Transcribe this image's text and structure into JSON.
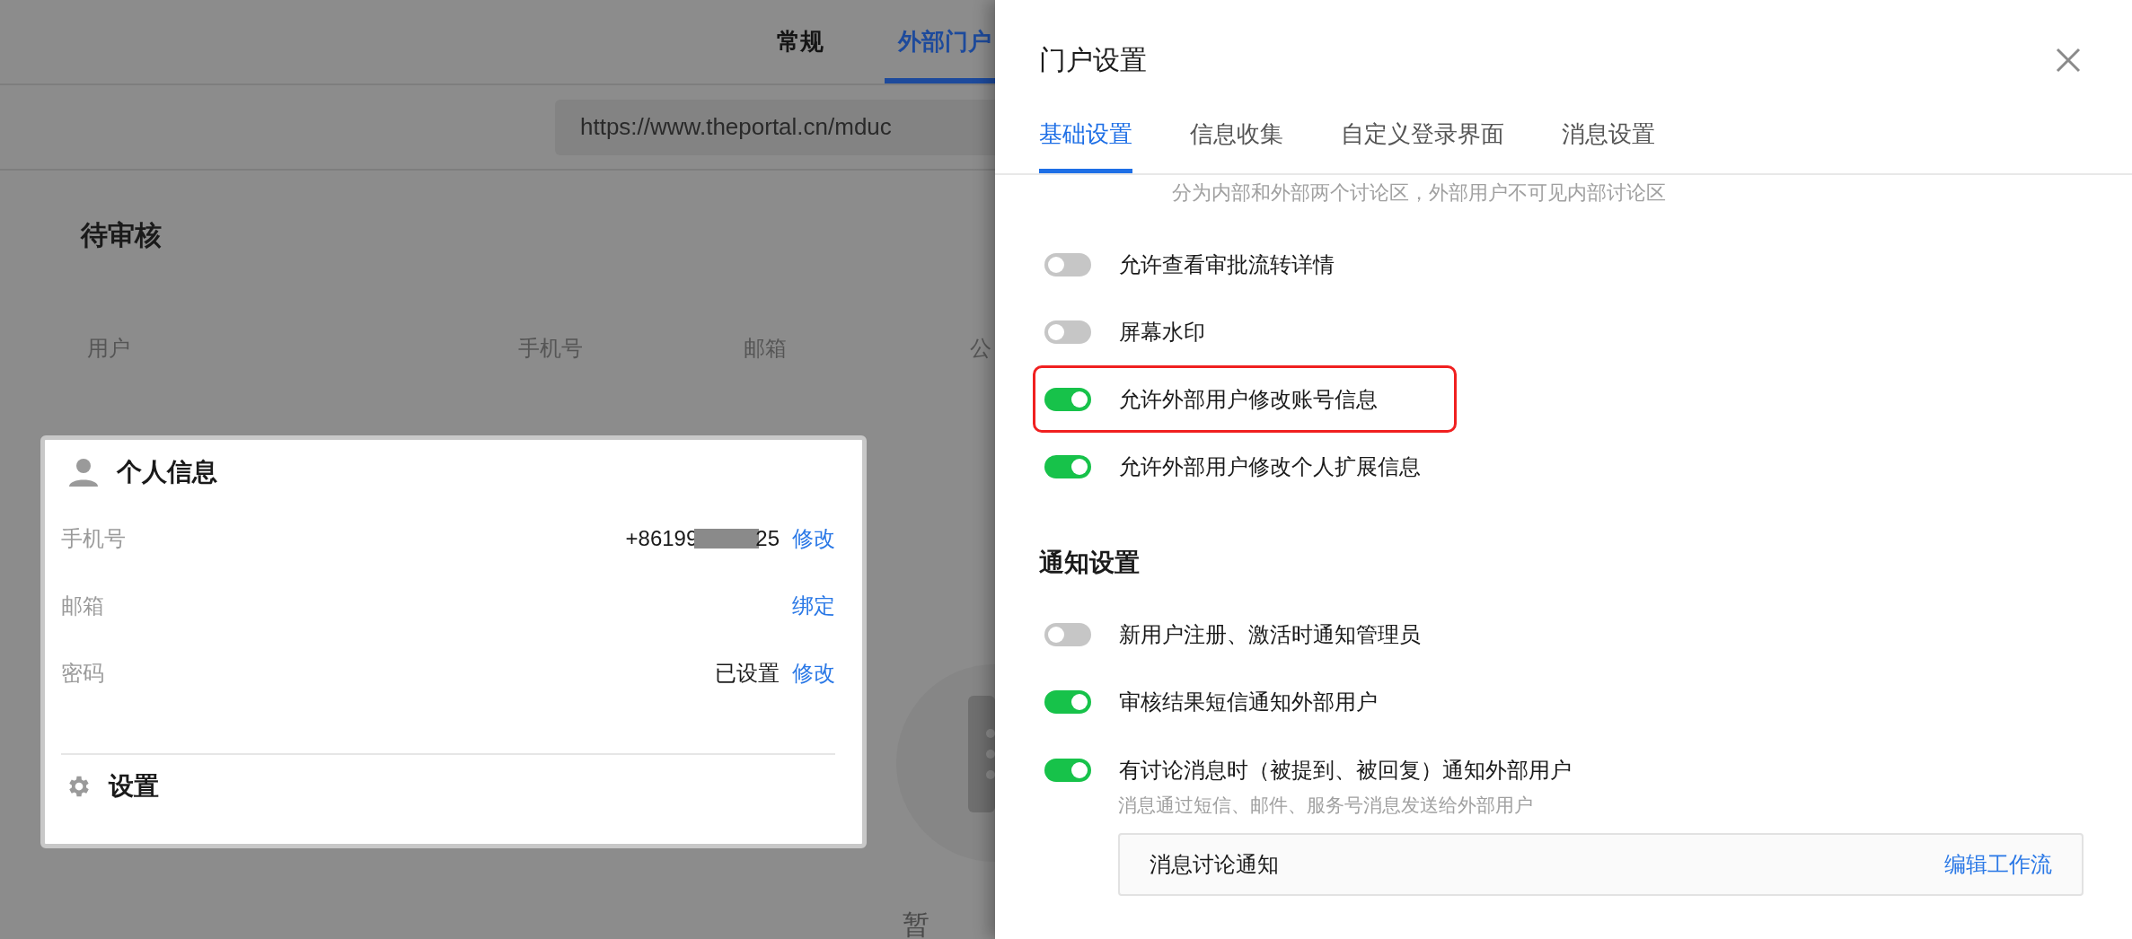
{
  "background_page": {
    "nav_tabs": [
      {
        "label": "常规",
        "selected": false
      },
      {
        "label": "外部门户",
        "selected": true
      }
    ],
    "url": "https://www.theportal.cn/mduc",
    "section_title": "待审核",
    "table": {
      "columns": [
        "用户",
        "手机号",
        "邮箱",
        "公"
      ]
    },
    "empty_text": "暂"
  },
  "profile_card": {
    "title": "个人信息",
    "rows": [
      {
        "label": "手机号",
        "value": "+86199",
        "value_tail": "25",
        "redacted": true,
        "action": "修改"
      },
      {
        "label": "邮箱",
        "action": "绑定"
      },
      {
        "label": "密码",
        "value": "已设置",
        "action": "修改"
      }
    ],
    "settings_label": "设置"
  },
  "drawer": {
    "title": "门户设置",
    "tabs": [
      {
        "label": "基础设置",
        "selected": true
      },
      {
        "label": "信息收集",
        "selected": false
      },
      {
        "label": "自定义登录界面",
        "selected": false
      },
      {
        "label": "消息设置",
        "selected": false
      }
    ],
    "items": [
      {
        "kind": "note",
        "text": "分为内部和外部两个讨论区，外部用户不可见内部讨论区"
      },
      {
        "kind": "toggle",
        "label": "允许查看审批流转详情",
        "on": false,
        "highlighted": false
      },
      {
        "kind": "toggle",
        "label": "屏幕水印",
        "on": false,
        "highlighted": false
      },
      {
        "kind": "toggle",
        "label": "允许外部用户修改账号信息",
        "on": true,
        "highlighted": true
      },
      {
        "kind": "toggle",
        "label": "允许外部用户修改个人扩展信息",
        "on": true,
        "highlighted": false
      },
      {
        "kind": "heading",
        "text": "通知设置"
      },
      {
        "kind": "toggle",
        "label": "新用户注册、激活时通知管理员",
        "on": false,
        "highlighted": false
      },
      {
        "kind": "toggle",
        "label": "审核结果短信通知外部用户",
        "on": true,
        "highlighted": false
      },
      {
        "kind": "toggle",
        "label": "有讨论消息时（被提到、被回复）通知外部用户",
        "on": true,
        "highlighted": false,
        "description": "消息通过短信、邮件、服务号消息发送给外部用户",
        "workflow": {
          "name": "消息讨论通知",
          "action": "编辑工作流"
        }
      }
    ]
  }
}
